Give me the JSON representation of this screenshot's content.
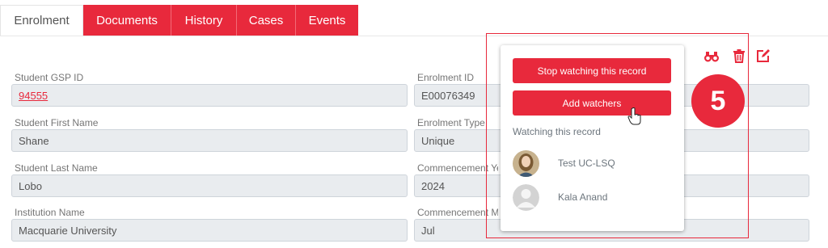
{
  "tabs": [
    {
      "label": "Enrolment",
      "active": true
    },
    {
      "label": "Documents",
      "active": false
    },
    {
      "label": "History",
      "active": false
    },
    {
      "label": "Cases",
      "active": false
    },
    {
      "label": "Events",
      "active": false
    }
  ],
  "toolbar": {
    "watch_icon": "binoculars-icon",
    "delete_icon": "trash-icon",
    "edit_icon": "edit-icon"
  },
  "fields": {
    "student_gsp_id": {
      "label": "Student GSP ID",
      "value": "94555"
    },
    "enrolment_id": {
      "label": "Enrolment ID",
      "value": "E00076349"
    },
    "student_first_name": {
      "label": "Student First Name",
      "value": "Shane"
    },
    "enrolment_type": {
      "label": "Enrolment Type",
      "value": "Unique"
    },
    "student_last_name": {
      "label": "Student Last Name",
      "value": "Lobo"
    },
    "commencement_year": {
      "label": "Commencement Ye",
      "value": "2024"
    },
    "institution_name": {
      "label": "Institution Name",
      "value": "Macquarie University"
    },
    "commencement_month": {
      "label": "Commencement M",
      "value": "Jul"
    }
  },
  "watch_popup": {
    "stop_button": "Stop watching this record",
    "add_button": "Add watchers",
    "heading": "Watching this record",
    "watchers": [
      {
        "name": "Test UC-LSQ"
      },
      {
        "name": "Kala Anand"
      }
    ]
  },
  "step_badge": "5",
  "colors": {
    "accent": "#e8293c",
    "field_bg": "#e9ecef"
  }
}
